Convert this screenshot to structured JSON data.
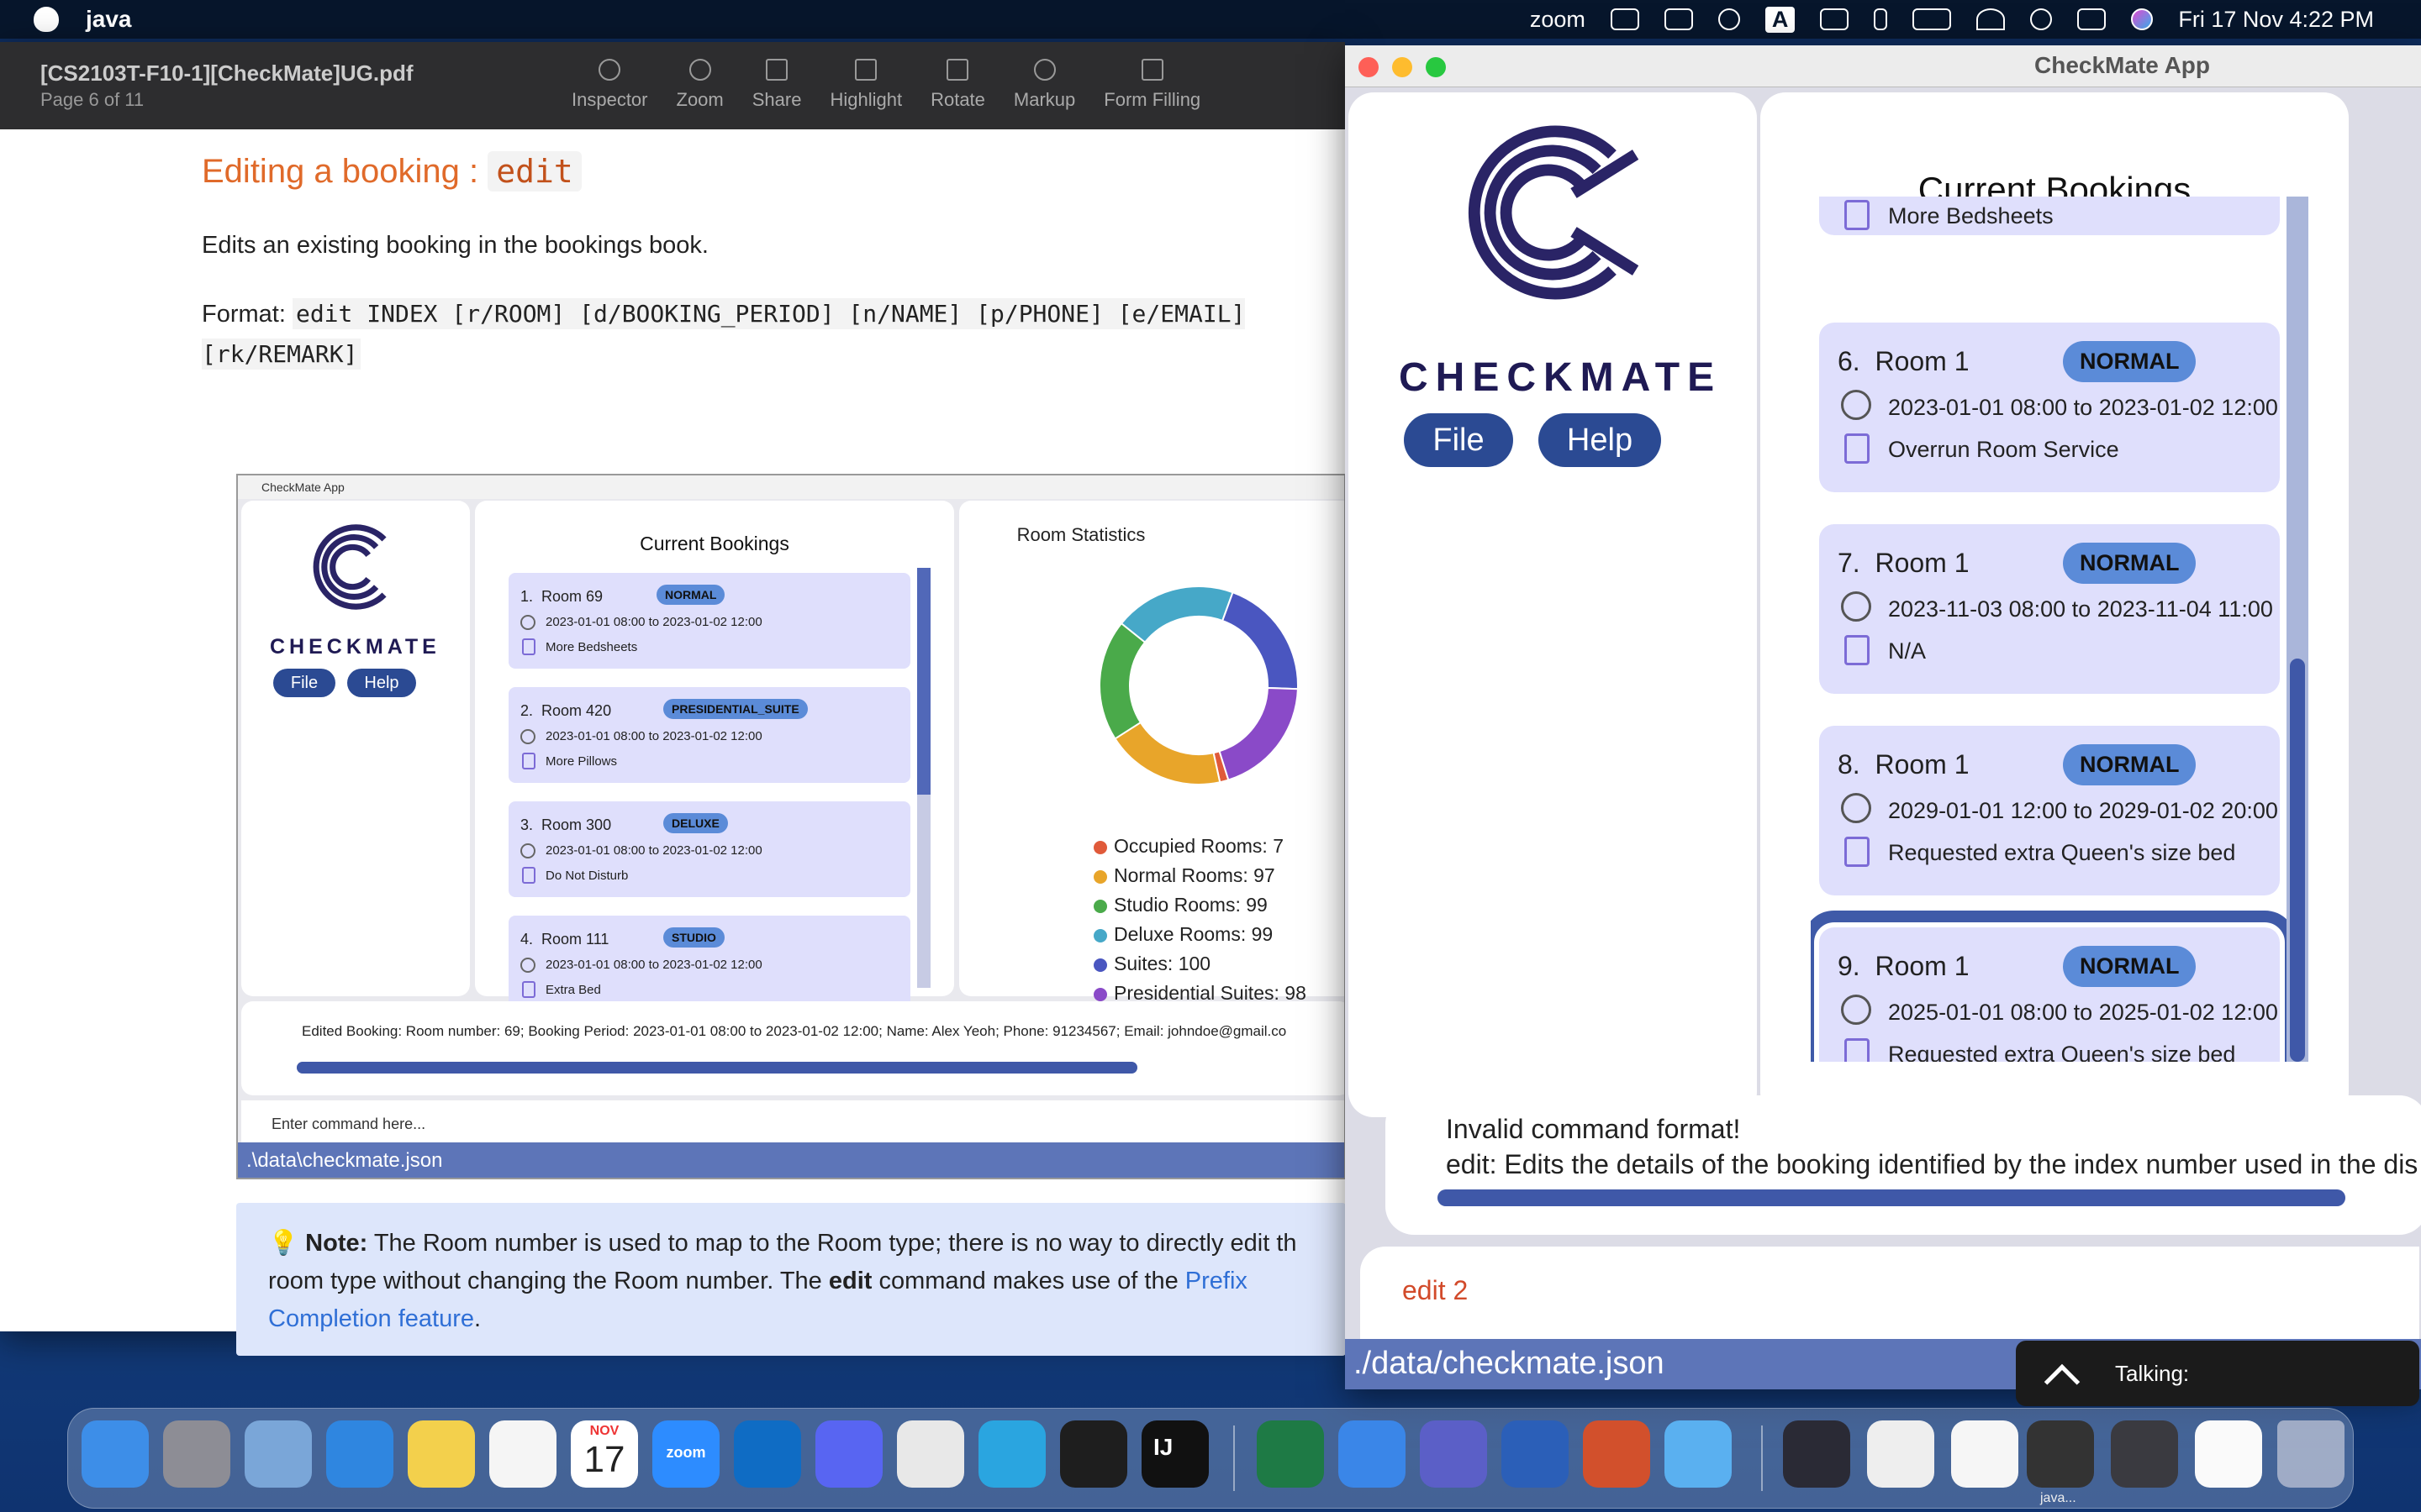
{
  "menubar": {
    "app_name": "java",
    "zoom_label": "zoom",
    "input_letter": "A",
    "datetime": "Fri 17 Nov  4:22 PM"
  },
  "preview": {
    "title": "[CS2103T-F10-1][CheckMate]UG.pdf",
    "page_label": "Page 6 of 11",
    "tools": [
      "Inspector",
      "Zoom",
      "Share",
      "Highlight",
      "Rotate",
      "Markup",
      "Form Filling"
    ],
    "heading": "Editing a booking : ",
    "heading_code": "edit",
    "paragraph": "Edits an existing booking in the bookings book.",
    "format_label": "Format: ",
    "format_code": "edit INDEX [r/ROOM] [d/BOOKING_PERIOD] [n/NAME] [p/PHONE] [e/EMAIL] [rk/REMARK]",
    "note_label": "Note:",
    "note_text_1": " The Room number is used to map to the Room type; there is no way to directly edit th",
    "note_text_2": "room type without changing the Room number. The ",
    "note_bold": "edit",
    "note_text_3": " command makes use of the ",
    "note_link_1": "Prefix",
    "note_link_2": "Completion feature",
    "note_end": "."
  },
  "embedded": {
    "window_title": "CheckMate App",
    "brand": "CHECKMATE",
    "file_btn": "File",
    "help_btn": "Help",
    "bookings_title": "Current Bookings",
    "bookings": [
      {
        "num": "1.",
        "room": "Room 69",
        "tag": "NORMAL",
        "period": "2023-01-01 08:00 to 2023-01-02 12:00",
        "remark": "More Bedsheets"
      },
      {
        "num": "2.",
        "room": "Room 420",
        "tag": "PRESIDENTIAL_SUITE",
        "period": "2023-01-01 08:00 to 2023-01-02 12:00",
        "remark": "More Pillows"
      },
      {
        "num": "3.",
        "room": "Room 300",
        "tag": "DELUXE",
        "period": "2023-01-01 08:00 to 2023-01-02 12:00",
        "remark": "Do Not Disturb"
      },
      {
        "num": "4.",
        "room": "Room 111",
        "tag": "STUDIO",
        "period": "2023-01-01 08:00 to 2023-01-02 12:00",
        "remark": "Extra Bed"
      }
    ],
    "stats_title": "Room Statistics",
    "stats": [
      {
        "label": "Occupied Rooms: 7",
        "color": "#e05a3a",
        "value": 7
      },
      {
        "label": "Normal Rooms: 97",
        "color": "#e8a52a",
        "value": 97
      },
      {
        "label": "Studio Rooms: 99",
        "color": "#4aaa4a",
        "value": 99
      },
      {
        "label": "Deluxe Rooms: 99",
        "color": "#46a8c8",
        "value": 99
      },
      {
        "label": "Suites: 100",
        "color": "#4a56c0",
        "value": 100
      },
      {
        "label": "Presidential Suites: 98",
        "color": "#8a4ac8",
        "value": 98
      }
    ],
    "result_text": "Edited Booking: Room number: 69; Booking Period: 2023-01-01 08:00 to 2023-01-02 12:00; Name: Alex Yeoh; Phone: 91234567; Email: johndoe@gmail.co",
    "command_placeholder": "Enter command here...",
    "status_path": ".\\data\\checkmate.json"
  },
  "checkmate": {
    "window_title": "CheckMate App",
    "brand": "CHECKMATE",
    "file_btn": "File",
    "help_btn": "Help",
    "bookings_title": "Current Bookings",
    "partial_remark": "More Bedsheets",
    "bookings": [
      {
        "num": "6.",
        "room": "Room 1",
        "tag": "NORMAL",
        "period": "2023-01-01 08:00 to 2023-01-02 12:00",
        "remark": "Overrun Room Service"
      },
      {
        "num": "7.",
        "room": "Room 1",
        "tag": "NORMAL",
        "period": "2023-11-03 08:00 to 2023-11-04 11:00",
        "remark": "N/A"
      },
      {
        "num": "8.",
        "room": "Room 1",
        "tag": "NORMAL",
        "period": "2029-01-01 12:00 to 2029-01-02 20:00",
        "remark": "Requested extra Queen's size bed"
      },
      {
        "num": "9.",
        "room": "Room 1",
        "tag": "NORMAL",
        "period": "2025-01-01 08:00 to 2025-01-02 12:00",
        "remark": "Requested extra Queen's size bed"
      }
    ],
    "result_line1": "Invalid command format!",
    "result_line2": "edit: Edits the details of the booking identified by the index number used in the dis",
    "command_value": "edit 2",
    "status_path": "./data/checkmate.json"
  },
  "zoom_popup": {
    "label": "Talking:"
  },
  "dock": {
    "calendar_month": "NOV",
    "calendar_day": "17",
    "zoom_text": "zoom",
    "intellij_text": "IJ",
    "java_label": "java...",
    "apps": [
      {
        "name": "finder",
        "color": "#3d8ee8"
      },
      {
        "name": "launchpad",
        "color": "#8d8d95"
      },
      {
        "name": "preview",
        "color": "#7aa6d8"
      },
      {
        "name": "safari",
        "color": "#2f86e0"
      },
      {
        "name": "notes",
        "color": "#f3d04c"
      },
      {
        "name": "freeform",
        "color": "#f5f5f5"
      },
      {
        "name": "calendar",
        "color": "#ffffff"
      },
      {
        "name": "zoom",
        "color": "#2d8cff"
      },
      {
        "name": "outlook",
        "color": "#0f6cc4"
      },
      {
        "name": "discord",
        "color": "#5865f2"
      },
      {
        "name": "chrome",
        "color": "#e8e8e8"
      },
      {
        "name": "telegram",
        "color": "#2aa5e0"
      },
      {
        "name": "terminal",
        "color": "#1e1e1e"
      },
      {
        "name": "intellij",
        "color": "#111111"
      },
      {
        "name": "excel",
        "color": "#1e7a45"
      },
      {
        "name": "maps",
        "color": "#3a86e8"
      },
      {
        "name": "teams",
        "color": "#5b5fc7"
      },
      {
        "name": "word",
        "color": "#2b5fb8"
      },
      {
        "name": "powerpoint",
        "color": "#d2502c"
      },
      {
        "name": "folder",
        "color": "#5ab0f0"
      }
    ]
  }
}
